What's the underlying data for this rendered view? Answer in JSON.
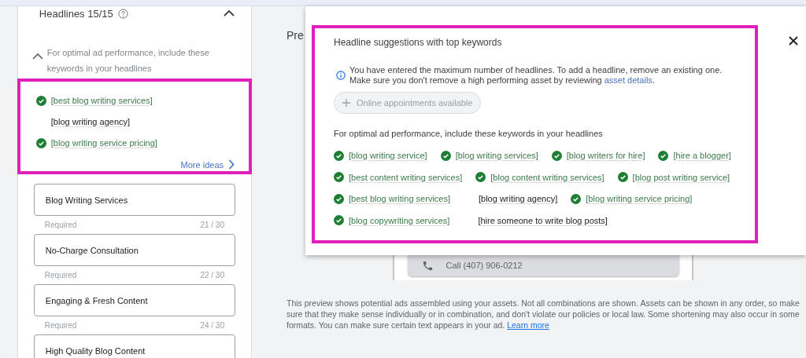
{
  "headlines_panel": {
    "title": "Headlines 15/15",
    "expanded": true,
    "hint": "For optimal ad performance, include these keywords in your headlines",
    "keywords": [
      {
        "text": "[best blog writing services]",
        "matched": true
      },
      {
        "text": "[blog writing agency]",
        "matched": false
      },
      {
        "text": "[blog writing service pricing]",
        "matched": true
      }
    ],
    "more_link": "More ideas",
    "fields": [
      {
        "value": "Blog Writing Services",
        "helper": "Required",
        "count": "21 / 30"
      },
      {
        "value": "No-Charge Consultation",
        "helper": "Required",
        "count": "22 / 30"
      },
      {
        "value": "Engaging & Fresh Content",
        "helper": "Required",
        "count": "24 / 30"
      },
      {
        "value": "High Quality Blog Content"
      }
    ]
  },
  "preview": {
    "title": "Pre",
    "call_button": "Call (407) 906-0212",
    "disclaimer": "This preview shows potential ads assembled using your assets. Not all combinations are shown. Assets can be shown in any order, so make sure that they make sense individually or in combination, and don't violate our policies or local law. Some shortening may also occur in some formats. You can make sure certain text appears in your ad.",
    "learn_more": "Learn more"
  },
  "suggestions_dialog": {
    "title": "Headline suggestions with top keywords",
    "info": "You have entered the maximum number of headlines. To add a headline, remove an existing one. Make sure you don't remove a high performing asset by reviewing",
    "info_link": "asset details",
    "info_end": ".",
    "chip": {
      "label": "Online appointments available",
      "disabled": true
    },
    "hint": "For optimal ad performance, include these keywords in your headlines",
    "keyword_rows": [
      {
        "keywords": [
          {
            "text": "[blog writing service]",
            "matched": true
          },
          {
            "text": "[blog writing services]",
            "matched": true
          },
          {
            "text": "[blog writers for hire]",
            "matched": true
          },
          {
            "text": "[hire a blogger]",
            "matched": true
          }
        ]
      },
      {
        "keywords": [
          {
            "text": "[best content writing services]",
            "matched": true
          },
          {
            "text": "[blog content writing services]",
            "matched": true
          },
          {
            "text": "[blog post writing service]",
            "matched": true
          }
        ]
      },
      {
        "keywords": [
          {
            "text": "[best blog writing services]",
            "matched": true
          },
          {
            "text": "[blog writing agency]",
            "matched": false
          },
          {
            "text": "[blog writing service pricing]",
            "matched": true
          }
        ]
      },
      {
        "keywords": [
          {
            "text": "[blog copywriting services]",
            "matched": true
          },
          {
            "text": "[hire someone to write blog posts]",
            "matched": false
          }
        ]
      }
    ]
  }
}
